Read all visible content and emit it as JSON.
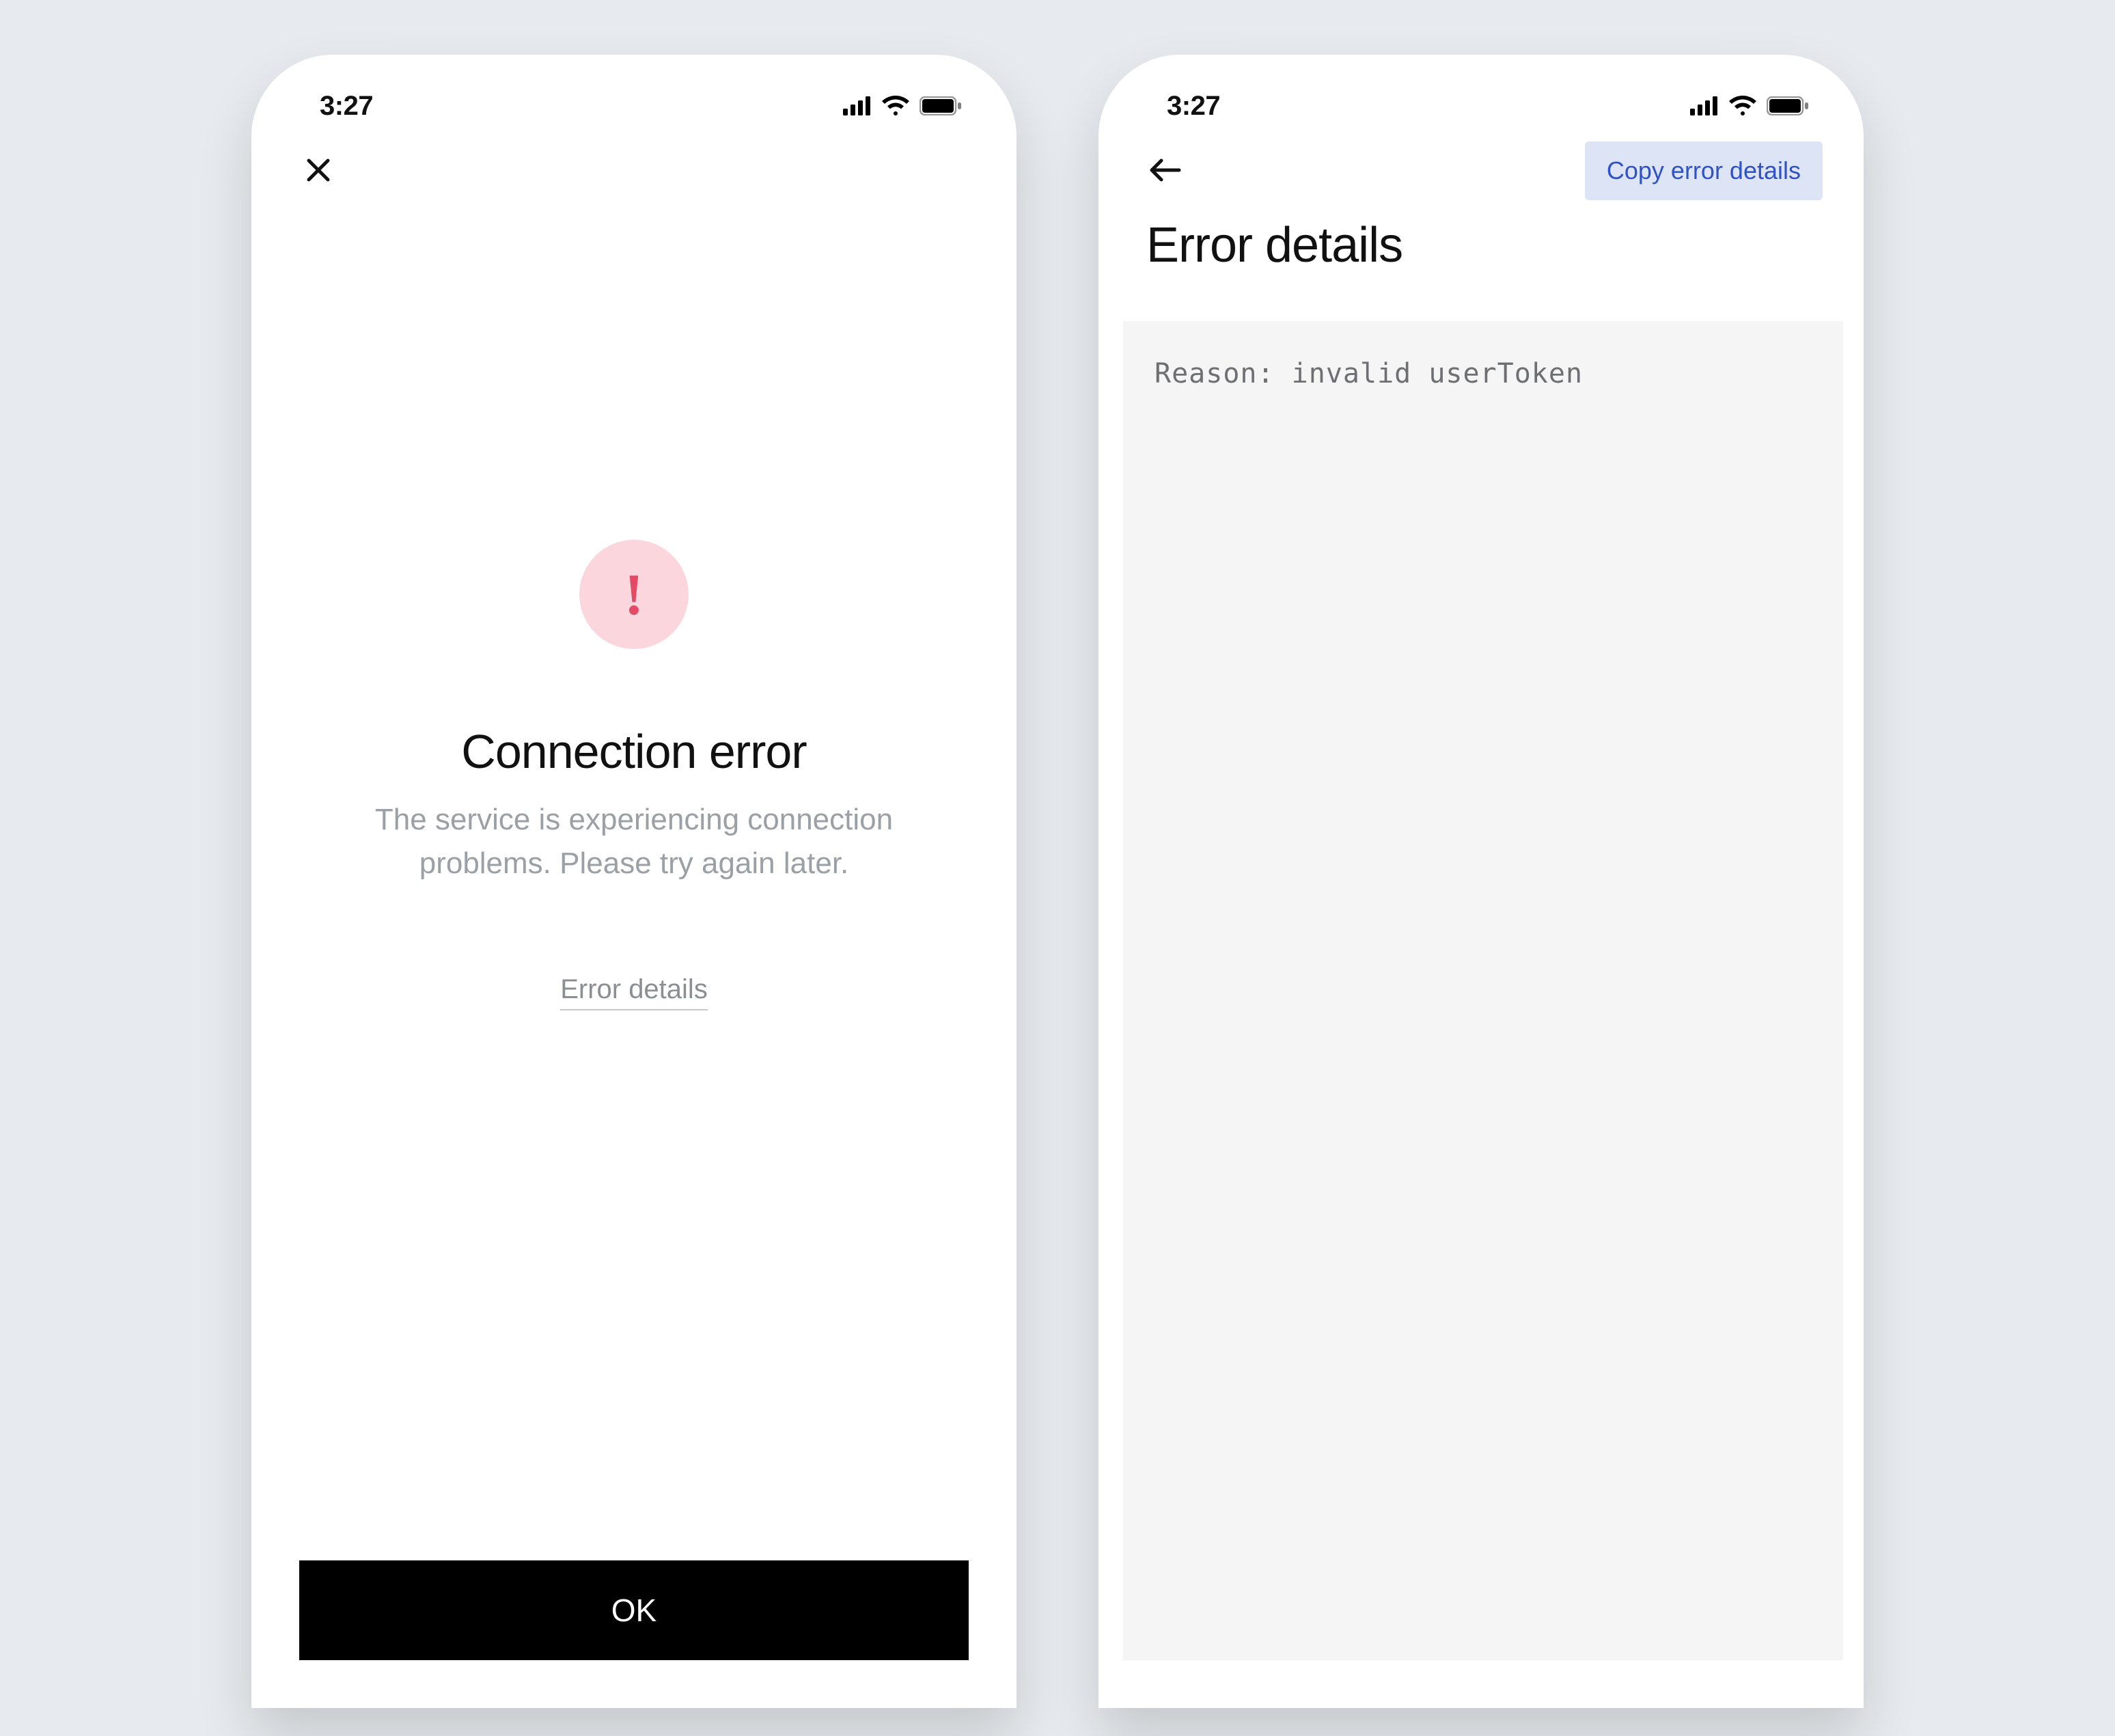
{
  "status": {
    "time": "3:27"
  },
  "error_screen": {
    "heading": "Connection error",
    "body": "The service is experiencing connection problems. Please try again later.",
    "details_link": "Error details",
    "ok_button": "OK"
  },
  "details_screen": {
    "title": "Error details",
    "copy_button": "Copy error details",
    "code": "Reason: invalid userToken"
  },
  "icons": {
    "close": "close-icon",
    "back": "back-arrow-icon",
    "exclaim": "exclamation-icon",
    "signal": "cellular-signal-icon",
    "wifi": "wifi-icon",
    "battery": "battery-icon"
  },
  "colors": {
    "page_bg": "#e7ebef",
    "accent_red": "#e44a66",
    "accent_red_bg": "#fbd7dd",
    "accent_blue": "#2f52c4",
    "accent_blue_bg": "#dde4f5",
    "button_bg": "#000000"
  }
}
